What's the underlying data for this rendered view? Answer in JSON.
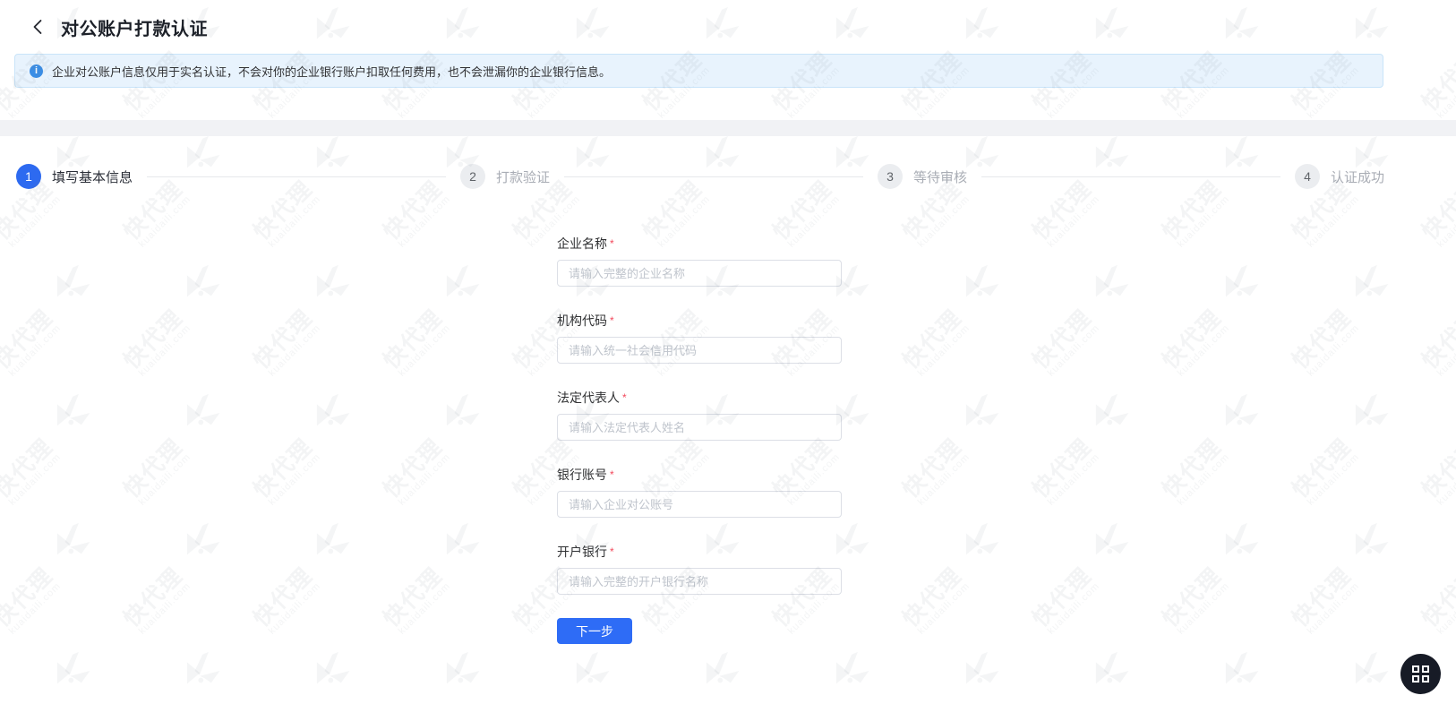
{
  "header": {
    "title": "对公账户打款认证"
  },
  "notice": {
    "text": "企业对公账户信息仅用于实名认证，不会对你的企业银行账户扣取任何费用，也不会泄漏你的企业银行信息。"
  },
  "steps": [
    {
      "number": "1",
      "label": "填写基本信息",
      "state": "active"
    },
    {
      "number": "2",
      "label": "打款验证",
      "state": "pending"
    },
    {
      "number": "3",
      "label": "等待审核",
      "state": "pending"
    },
    {
      "number": "4",
      "label": "认证成功",
      "state": "pending"
    }
  ],
  "form": {
    "required_mark": "*",
    "fields": [
      {
        "label": "企业名称",
        "required": true,
        "placeholder": "请输入完整的企业名称",
        "value": ""
      },
      {
        "label": "机构代码",
        "required": true,
        "placeholder": "请输入统一社会信用代码",
        "value": ""
      },
      {
        "label": "法定代表人",
        "required": true,
        "placeholder": "请输入法定代表人姓名",
        "value": ""
      },
      {
        "label": "银行账号",
        "required": true,
        "placeholder": "请输入企业对公账号",
        "value": ""
      },
      {
        "label": "开户银行",
        "required": true,
        "placeholder": "请输入完整的开户银行名称",
        "value": ""
      }
    ],
    "submit_label": "下一步"
  },
  "watermark": {
    "brand": "快代理",
    "domain": "kuaidaili.com"
  },
  "colors": {
    "primary": "#2e6cf6",
    "step_active": "#2d6af0",
    "banner_bg": "#e8f3fd",
    "banner_border": "#c9e4f9",
    "info_icon": "#3a8ee6",
    "asterisk": "#f2495c",
    "fab_bg": "#171b26",
    "gray_band": "#f1f2f5"
  }
}
